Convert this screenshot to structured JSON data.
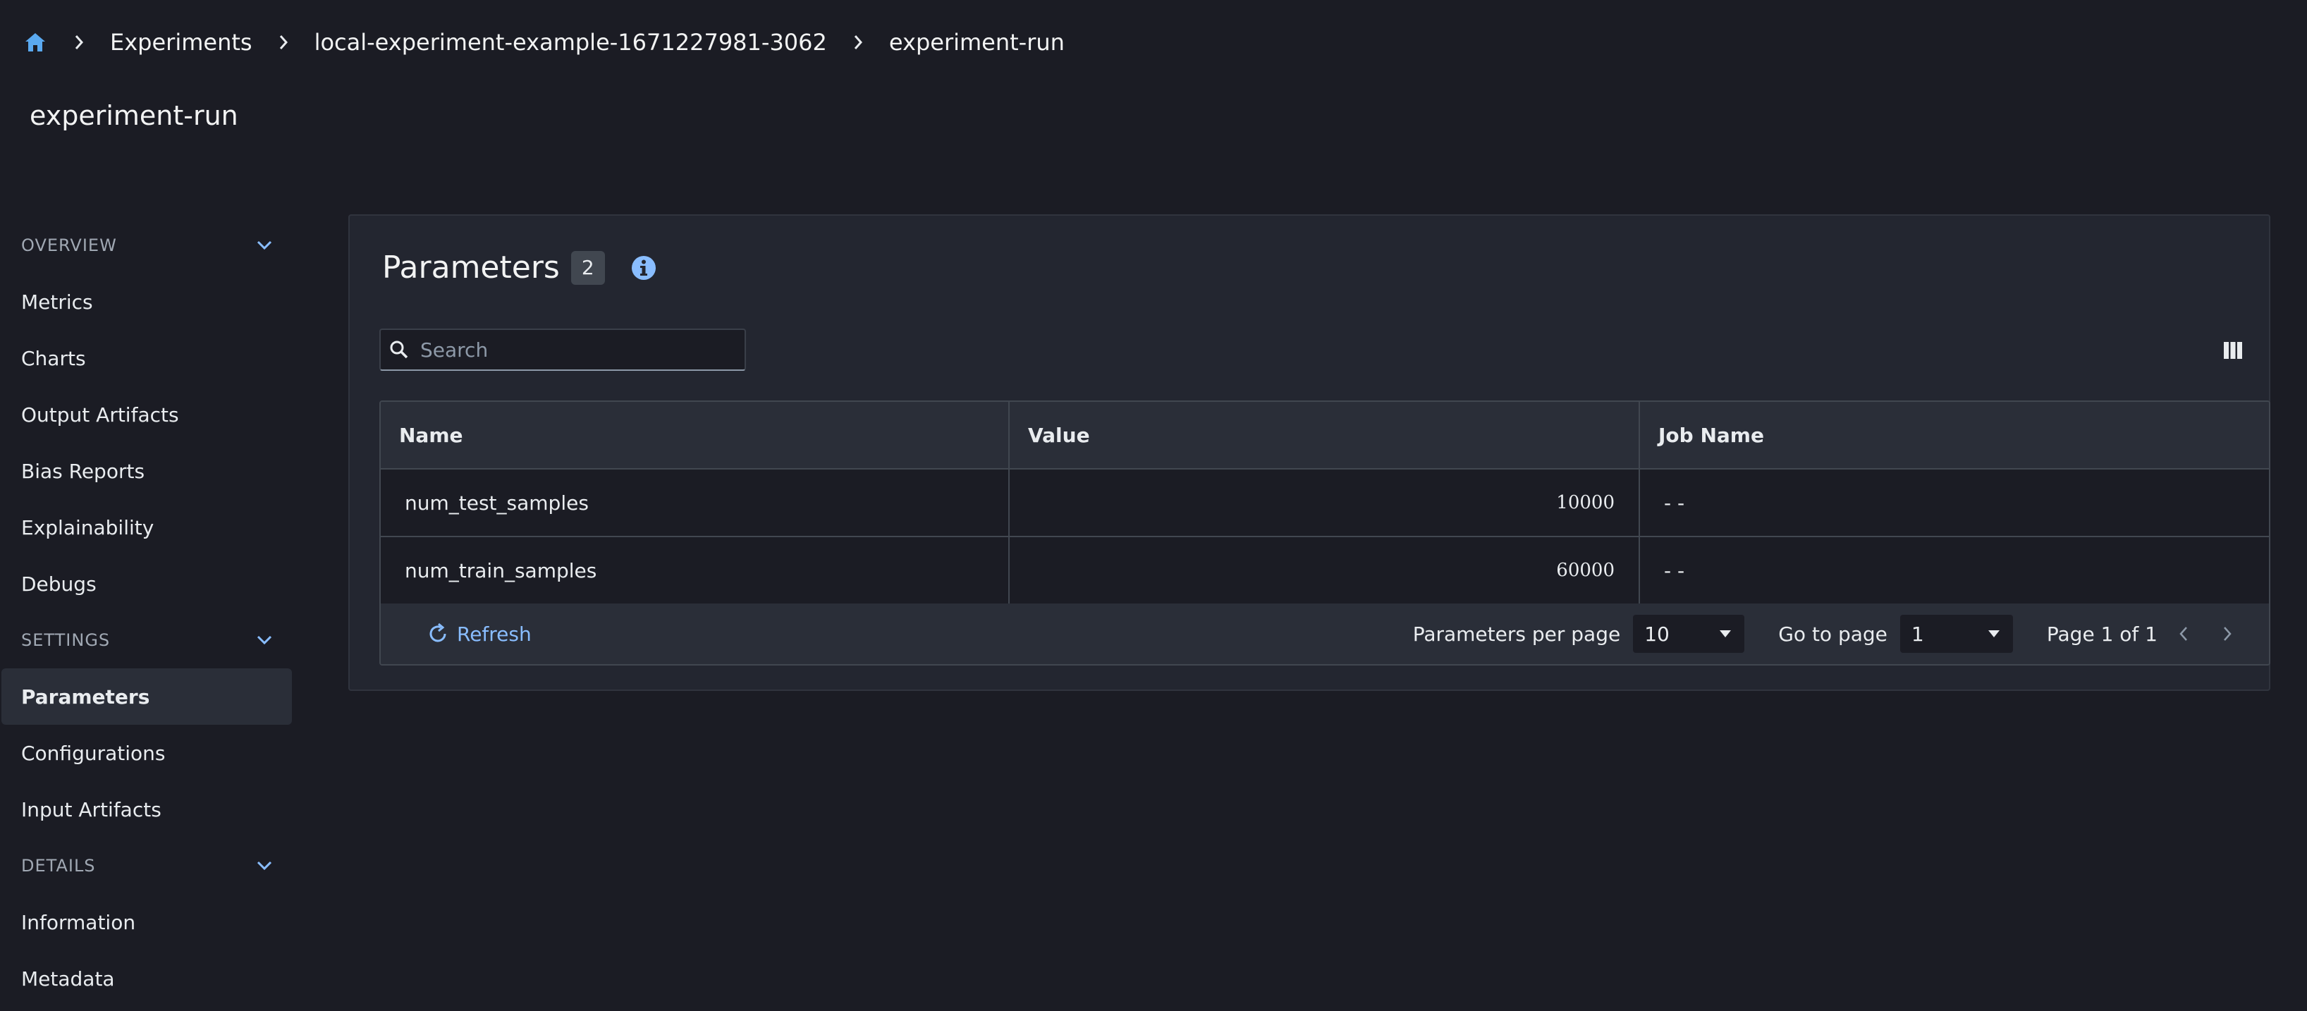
{
  "breadcrumb": {
    "items": [
      "Experiments",
      "local-experiment-example-1671227981-3062",
      "experiment-run"
    ]
  },
  "page_title": "experiment-run",
  "sidebar": {
    "sections": [
      {
        "label": "OVERVIEW",
        "items": [
          "Metrics",
          "Charts",
          "Output Artifacts",
          "Bias Reports",
          "Explainability",
          "Debugs"
        ]
      },
      {
        "label": "SETTINGS",
        "items": [
          "Parameters",
          "Configurations",
          "Input Artifacts"
        ]
      },
      {
        "label": "DETAILS",
        "items": [
          "Information",
          "Metadata"
        ]
      }
    ],
    "active": "Parameters"
  },
  "panel": {
    "title": "Parameters",
    "count": "2",
    "search_placeholder": "Search",
    "columns": [
      "Name",
      "Value",
      "Job Name"
    ],
    "rows": [
      {
        "name": "num_test_samples",
        "value": "10000",
        "job": "- -"
      },
      {
        "name": "num_train_samples",
        "value": "60000",
        "job": "- -"
      }
    ],
    "footer": {
      "refresh": "Refresh",
      "per_page_label": "Parameters per page",
      "per_page_value": "10",
      "goto_label": "Go to page",
      "goto_value": "1",
      "page_label": "Page 1 of 1"
    }
  },
  "colors": {
    "accent": "#89bdff",
    "home_icon": "#5aa9f0"
  }
}
